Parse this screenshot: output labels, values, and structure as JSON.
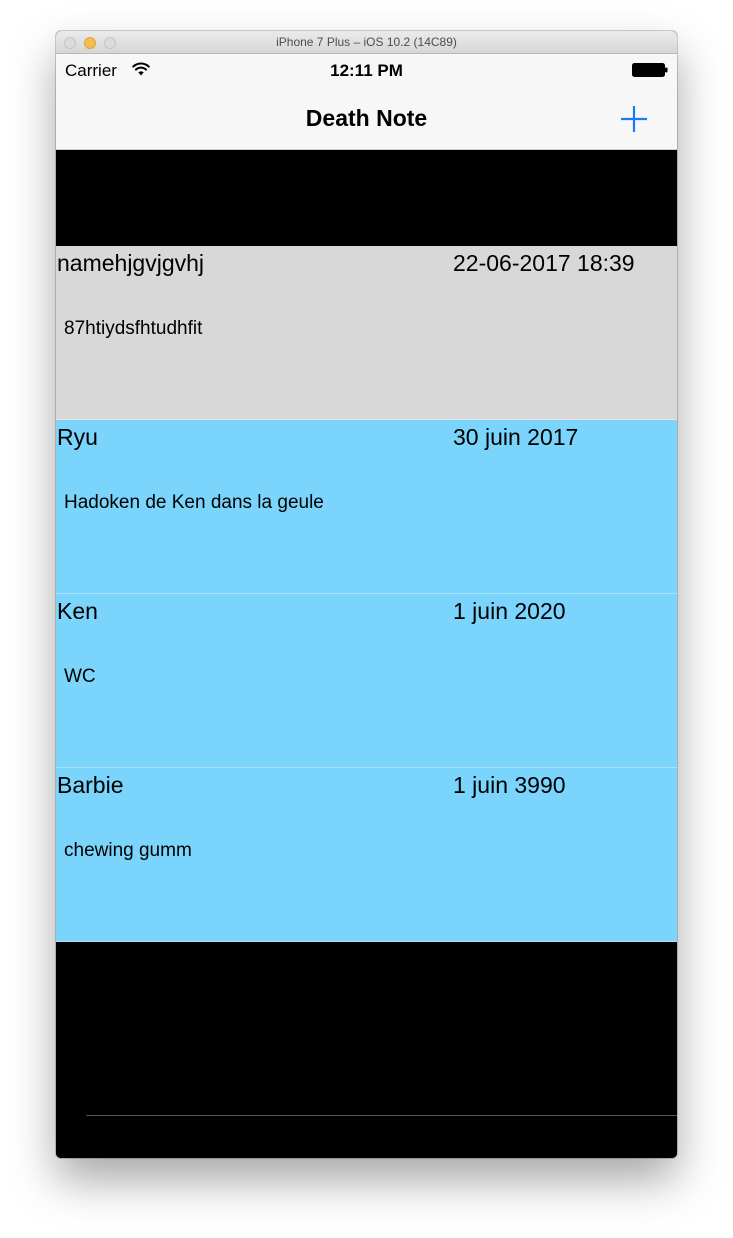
{
  "window": {
    "title": "iPhone 7 Plus – iOS 10.2 (14C89)"
  },
  "statusbar": {
    "carrier": "Carrier",
    "time": "12:11 PM"
  },
  "navbar": {
    "title": "Death Note",
    "add_icon": "plus-icon",
    "accent_color": "#1a7cf5"
  },
  "notes": [
    {
      "name": "namehjgvjgvhj",
      "date": "22-06-2017 18:39",
      "description": "87htiydsfhtudhfit",
      "background": "#d8d8d8"
    },
    {
      "name": "Ryu",
      "date": "30 juin 2017",
      "description": "Hadoken de Ken dans la geule",
      "background": "#7ad4fc"
    },
    {
      "name": "Ken",
      "date": "1 juin 2020",
      "description": "WC",
      "background": "#7ad4fc"
    },
    {
      "name": "Barbie",
      "date": "1 juin 3990",
      "description": "chewing gumm",
      "background": "#7ad4fc"
    }
  ]
}
